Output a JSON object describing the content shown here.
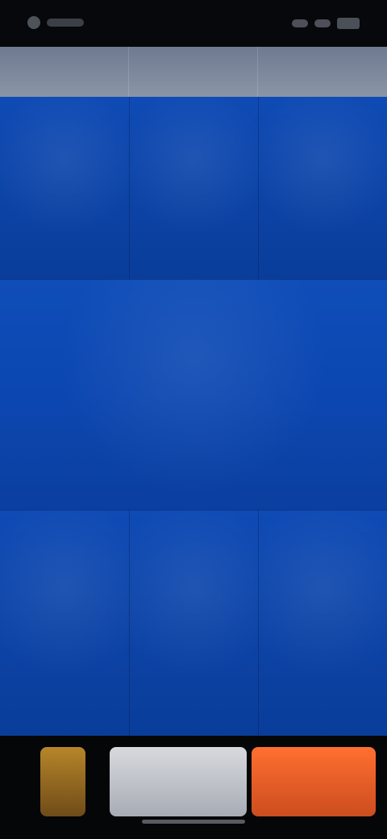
{
  "status_bar": {
    "time": "",
    "battery": ""
  },
  "header": {
    "cells": [
      {
        "label": ""
      },
      {
        "label": ""
      },
      {
        "label": ""
      }
    ]
  },
  "grid": {
    "top_row": [
      {
        "title": "",
        "subtitle": ""
      },
      {
        "title": "",
        "subtitle": ""
      },
      {
        "title": "",
        "subtitle": ""
      }
    ],
    "middle": {
      "title": "",
      "subtitle": ""
    },
    "bottom_row": [
      {
        "title": "",
        "subtitle": ""
      },
      {
        "title": "",
        "subtitle": ""
      },
      {
        "title": "",
        "subtitle": ""
      }
    ]
  },
  "bottom_strip": {
    "items": [
      {
        "label": ""
      },
      {
        "label": ""
      },
      {
        "label": ""
      }
    ]
  },
  "colors": {
    "grid_blue": "#0c3f9e",
    "header_gray": "#8b95a8",
    "accent_orange": "#ff6f30",
    "accent_gold": "#b6862a"
  }
}
